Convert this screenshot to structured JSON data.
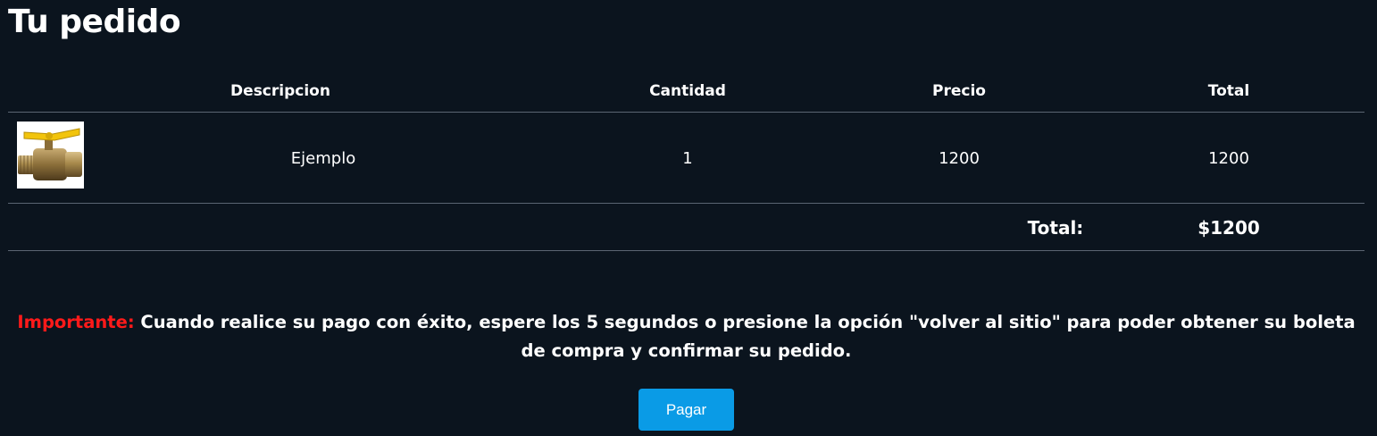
{
  "page": {
    "title": "Tu pedido"
  },
  "colors": {
    "background": "#0b141e",
    "important": "#ff1a1a",
    "button": "#0a9be6"
  },
  "table": {
    "columns": [
      "Descripcion",
      "Cantidad",
      "Precio",
      "Total"
    ],
    "rows": [
      {
        "image": "brass-ball-valve-product-photo",
        "description": "Ejemplo",
        "quantity": "1",
        "price": "1200",
        "total": "1200"
      }
    ],
    "summary": {
      "label": "Total:",
      "value": "$1200"
    }
  },
  "notice": {
    "label": "Importante:",
    "text": " Cuando realice su pago con éxito, espere los 5 segundos o presione la opción \"volver al sitio\" para poder obtener su boleta de compra y confirmar su pedido."
  },
  "actions": {
    "pay_label": "Pagar"
  }
}
